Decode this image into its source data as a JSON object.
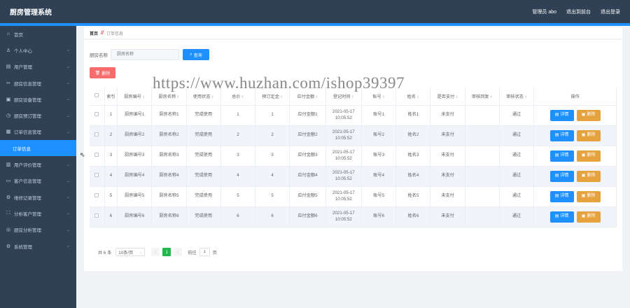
{
  "header": {
    "title": "厨房管理系统",
    "user_label": "管理员 abo",
    "back_label": "退出到前台",
    "logout_label": "退出登录"
  },
  "sidebar": {
    "items": [
      {
        "label": "首页",
        "icon": "home-icon",
        "chev": false
      },
      {
        "label": "个人中心",
        "icon": "user-icon",
        "chev": true
      },
      {
        "label": "用户管理",
        "icon": "file-icon",
        "chev": true
      },
      {
        "label": "厨房信息管理",
        "icon": "tools-icon",
        "chev": true
      },
      {
        "label": "厨房设备管理",
        "icon": "briefcase-icon",
        "chev": true
      },
      {
        "label": "厨房预订管理",
        "icon": "clock-icon",
        "chev": true
      },
      {
        "label": "订单信息管理",
        "icon": "grid-icon",
        "chev": true
      },
      {
        "label": "订单信息",
        "icon": "",
        "chev": false
      },
      {
        "label": "用户评价管理",
        "icon": "doc-icon",
        "chev": true
      },
      {
        "label": "客户信息管理",
        "icon": "folder-icon",
        "chev": true
      },
      {
        "label": "维修记录管理",
        "icon": "wrench-icon",
        "chev": true
      },
      {
        "label": "分析客户管理",
        "icon": "frame-icon",
        "chev": true
      },
      {
        "label": "厨房分析管理",
        "icon": "target-icon",
        "chev": true
      },
      {
        "label": "系统管理",
        "icon": "settings-icon",
        "chev": true
      }
    ]
  },
  "breadcrumb": {
    "home": "首页",
    "current": "订单信息"
  },
  "search": {
    "label": "厨房名称",
    "placeholder": "厨房名称",
    "button": "查询"
  },
  "batch_delete": "删除",
  "table": {
    "headers": [
      "索引",
      "厨房编号",
      "厨房名称",
      "使用状态",
      "总价",
      "预订定金",
      "应付金额",
      "登记时间",
      "账号",
      "姓名",
      "是否支付",
      "审核回复",
      "审核状态",
      "操作"
    ],
    "rows": [
      {
        "index": "1",
        "code": "厨房编号1",
        "name": "厨房名称1",
        "status": "完成使用",
        "total": "1",
        "deposit": "1",
        "due": "应付金额1",
        "date": "2021-05-17",
        "time": "10:05:52",
        "account": "账号1",
        "person": "姓名1",
        "paid": "未支付",
        "reply": "",
        "audit": "通过"
      },
      {
        "index": "2",
        "code": "厨房编号2",
        "name": "厨房名称2",
        "status": "完成使用",
        "total": "2",
        "deposit": "2",
        "due": "应付金额2",
        "date": "2021-05-17",
        "time": "10:05:52",
        "account": "账号2",
        "person": "姓名2",
        "paid": "未支付",
        "reply": "",
        "audit": "通过"
      },
      {
        "index": "3",
        "code": "厨房编号3",
        "name": "厨房名称3",
        "status": "完成使用",
        "total": "3",
        "deposit": "3",
        "due": "应付金额3",
        "date": "2021-05-17",
        "time": "10:05:52",
        "account": "账号3",
        "person": "姓名3",
        "paid": "未支付",
        "reply": "",
        "audit": "通过"
      },
      {
        "index": "4",
        "code": "厨房编号4",
        "name": "厨房名称4",
        "status": "完成使用",
        "total": "4",
        "deposit": "4",
        "due": "应付金额4",
        "date": "2021-05-17",
        "time": "10:05:52",
        "account": "账号4",
        "person": "姓名4",
        "paid": "未支付",
        "reply": "",
        "audit": "通过"
      },
      {
        "index": "5",
        "code": "厨房编号5",
        "name": "厨房名称5",
        "status": "完成使用",
        "total": "5",
        "deposit": "5",
        "due": "应付金额5",
        "date": "2021-05-17",
        "time": "10:05:52",
        "account": "账号5",
        "person": "姓名5",
        "paid": "未支付",
        "reply": "",
        "audit": "通过"
      },
      {
        "index": "6",
        "code": "厨房编号6",
        "name": "厨房名称6",
        "status": "完成使用",
        "total": "6",
        "deposit": "6",
        "due": "应付金额6",
        "date": "2021-05-17",
        "time": "10:05:52",
        "account": "账号6",
        "person": "姓名6",
        "paid": "未支付",
        "reply": "",
        "audit": "通过"
      }
    ],
    "detail_label": "详情",
    "delete_label": "删除"
  },
  "pager": {
    "total": "共 6 条",
    "page_size": "10条/页",
    "current_page": "1",
    "goto_prefix": "前往",
    "goto_value": "1",
    "goto_suffix": "页"
  },
  "watermark": "https://www.huzhan.com/ishop39397",
  "colors": {
    "header_bg": "#304156",
    "accent": "#1e90ff",
    "danger": "#f56c6c",
    "warning": "#e6a23c",
    "pager_active": "#20b94c"
  }
}
